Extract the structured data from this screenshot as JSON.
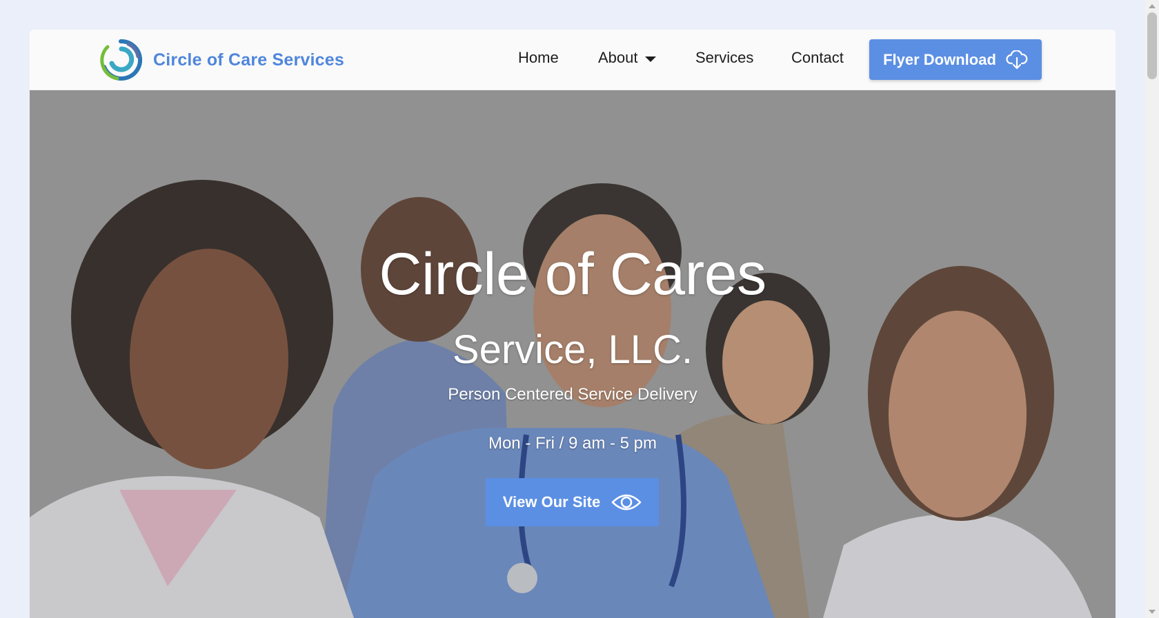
{
  "brand": {
    "name": "Circle of Care Services",
    "logo_icon": "circle-swirl-logo",
    "color": "#4f86dc"
  },
  "nav": {
    "items": [
      {
        "label": "Home"
      },
      {
        "label": "About",
        "has_dropdown": true
      },
      {
        "label": "Services"
      },
      {
        "label": "Contact"
      }
    ],
    "cta": {
      "label": "Flyer Download",
      "icon": "cloud-download-icon"
    }
  },
  "hero": {
    "title": "Circle of Cares",
    "subtitle": "Service, LLC.",
    "tagline": "Person Centered Service Delivery",
    "hours": "Mon - Fri / 9 am - 5 pm",
    "button": {
      "label": "View Our Site",
      "icon": "eye-icon"
    }
  },
  "colors": {
    "accent": "#5b8fe4",
    "page_background": "#eaeff9"
  }
}
